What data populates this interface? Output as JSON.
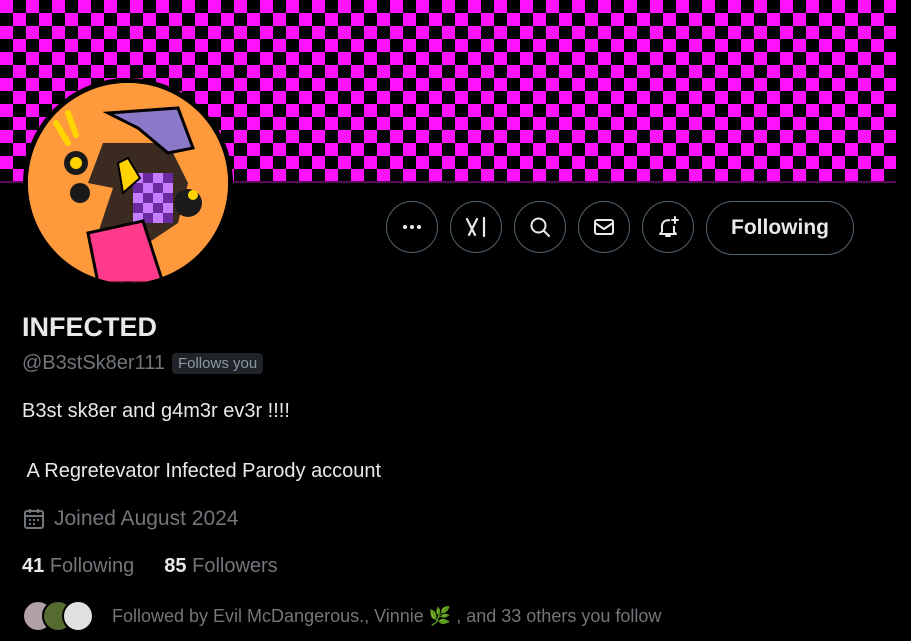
{
  "profile": {
    "display_name": "INFECTED",
    "handle": "@B3stSk8er111",
    "follows_you_label": "Follows you",
    "bio_line1": "B3st sk8er and g4m3r ev3r !!!!",
    "bio_line2": " A Regretevator Infected Parody account",
    "joined": "Joined August 2024",
    "following_count": "41",
    "following_label": "Following",
    "followers_count": "85",
    "followers_label": "Followers",
    "followed_by_text": "Followed by Evil McDangerous., Vinnie 🌿 , and 33 others you follow"
  },
  "actions": {
    "more_icon": "more-icon",
    "grok_icon": "grok-icon",
    "search_icon": "search-icon",
    "message_icon": "message-icon",
    "notify_icon": "notify-icon",
    "follow_button_label": "Following"
  },
  "colors": {
    "banner_pink": "#ff13ff",
    "banner_black": "#000000",
    "avatar_orange": "#ff9a3c",
    "text_primary": "#e7e9ea",
    "text_secondary": "#71767b",
    "border": "#536471"
  }
}
